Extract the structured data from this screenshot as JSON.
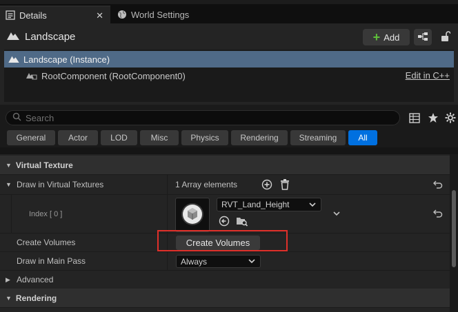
{
  "tabs": [
    {
      "label": "Details",
      "icon": "details-icon",
      "active": true
    },
    {
      "label": "World Settings",
      "icon": "globe-icon",
      "active": false
    }
  ],
  "header": {
    "actor_name": "Landscape",
    "add_label": "Add"
  },
  "components": {
    "selected": "Landscape (Instance)",
    "child": "RootComponent (RootComponent0)",
    "edit_link": "Edit in C++"
  },
  "search": {
    "placeholder": "Search"
  },
  "filters": [
    "General",
    "Actor",
    "LOD",
    "Misc",
    "Physics",
    "Rendering",
    "Streaming",
    "All"
  ],
  "active_filter": "All",
  "properties": {
    "cat_virtual_texture": "Virtual Texture",
    "draw_in_vt_label": "Draw in Virtual Textures",
    "array_count": "1 Array elements",
    "index_label": "Index [ 0 ]",
    "asset_name": "RVT_Land_Height",
    "create_volumes_label": "Create Volumes",
    "create_volumes_button": "Create Volumes",
    "draw_main_pass_label": "Draw in Main Pass",
    "draw_main_pass_value": "Always",
    "cat_advanced": "Advanced",
    "cat_rendering": "Rendering"
  },
  "colors": {
    "selection": "#4f6a87",
    "accent_blue": "#0070e0",
    "add_green": "#5ec03a",
    "highlight_red": "#e0302a"
  }
}
